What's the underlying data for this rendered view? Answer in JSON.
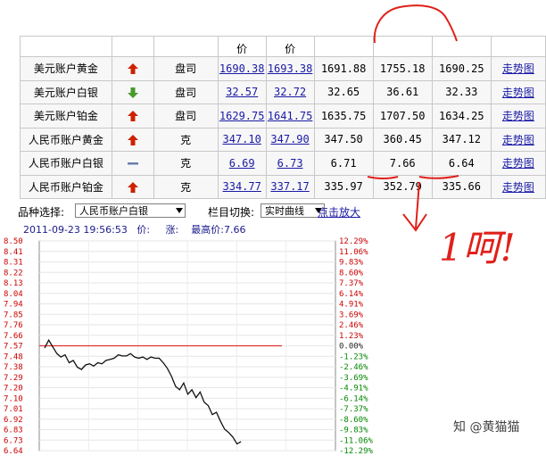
{
  "table": {
    "headers": [
      "",
      "",
      "",
      "价",
      "价",
      "",
      "",
      "",
      ""
    ],
    "rows": [
      {
        "name": "美元账户黄金",
        "dir": "up",
        "unit": "盘司",
        "bid": "1690.38",
        "ask": "1693.38",
        "mid": "1691.88",
        "high": "1755.18",
        "low": "1690.25",
        "trend": "走势图"
      },
      {
        "name": "美元账户白银",
        "dir": "down",
        "unit": "盘司",
        "bid": "32.57",
        "ask": "32.72",
        "mid": "32.65",
        "high": "36.61",
        "low": "32.33",
        "trend": "走势图"
      },
      {
        "name": "美元账户铂金",
        "dir": "up",
        "unit": "盘司",
        "bid": "1629.75",
        "ask": "1641.75",
        "mid": "1635.75",
        "high": "1707.50",
        "low": "1634.25",
        "trend": "走势图"
      },
      {
        "name": "人民币账户黄金",
        "dir": "up",
        "unit": "克",
        "bid": "347.10",
        "ask": "347.90",
        "mid": "347.50",
        "high": "360.45",
        "low": "347.12",
        "trend": "走势图"
      },
      {
        "name": "人民币账户白银",
        "dir": "flat",
        "unit": "克",
        "bid": "6.69",
        "ask": "6.73",
        "mid": "6.71",
        "high": "7.66",
        "low": "6.64",
        "trend": "走势图"
      },
      {
        "name": "人民币账户铂金",
        "dir": "up",
        "unit": "克",
        "bid": "334.77",
        "ask": "337.17",
        "mid": "335.97",
        "high": "352.79",
        "low": "335.66",
        "trend": "走势图"
      }
    ]
  },
  "controls": {
    "variety_label": "品种选择:",
    "variety_value": "人民币账户白银",
    "column_label": "栏目切换:",
    "column_value": "实时曲线",
    "enlarge_link": "点击放大"
  },
  "info": {
    "datetime": "2011-09-23 19:56:53",
    "price_label": "价:",
    "change_label": "涨:",
    "high_label": "最高价:",
    "high_value": "7.66"
  },
  "annotation": {
    "text": "1呵!"
  },
  "watermark": "知 @黄猫猫",
  "colors": {
    "up": "#cc2200",
    "down": "#4a9a2a",
    "flat": "#6a7fb0",
    "link": "#1a1aa6",
    "ref_line": "#e03030",
    "pct_up": "#cc0000",
    "pct_down": "#008800",
    "ink": "#e0201a"
  },
  "chart_data": {
    "type": "line",
    "y_left_ticks": [
      "8.50",
      "8.41",
      "8.31",
      "8.22",
      "8.13",
      "8.04",
      "7.94",
      "7.85",
      "7.76",
      "7.66",
      "7.57",
      "7.48",
      "7.38",
      "7.29",
      "7.20",
      "7.10",
      "7.01",
      "6.92",
      "6.83",
      "6.73",
      "6.64"
    ],
    "y_right_ticks": [
      "12.29%",
      "11.06%",
      "9.83%",
      "8.60%",
      "7.37%",
      "6.14%",
      "4.91%",
      "3.69%",
      "2.46%",
      "1.23%",
      "0.00%",
      "-1.23%",
      "-2.46%",
      "-3.69%",
      "-4.91%",
      "-6.14%",
      "-7.37%",
      "-8.60%",
      "-9.83%",
      "-11.06%",
      "-12.29%"
    ],
    "ylim": [
      6.64,
      8.5
    ],
    "reference": 7.57,
    "x": [
      0,
      5,
      10,
      15,
      20,
      25,
      30,
      35,
      40,
      45,
      50,
      55,
      60,
      65,
      70,
      75,
      80,
      85,
      90,
      95,
      100,
      105,
      110,
      115,
      120,
      125,
      130,
      135,
      140,
      145,
      150,
      155,
      160,
      165,
      170,
      175,
      180,
      185,
      190,
      195,
      200,
      205,
      210,
      215,
      220,
      225,
      230,
      235,
      240,
      245,
      250,
      255,
      260,
      265,
      270,
      275,
      280,
      285,
      290
    ],
    "values": [
      7.55,
      7.62,
      7.56,
      7.5,
      7.47,
      7.49,
      7.42,
      7.44,
      7.38,
      7.36,
      7.4,
      7.41,
      7.39,
      7.42,
      7.41,
      7.44,
      7.45,
      7.46,
      7.49,
      7.48,
      7.48,
      7.5,
      7.47,
      7.46,
      7.47,
      7.45,
      7.47,
      7.46,
      7.46,
      7.42,
      7.37,
      7.3,
      7.21,
      7.18,
      7.24,
      7.14,
      7.18,
      7.11,
      7.16,
      7.07,
      7.04,
      6.96,
      6.98,
      6.9,
      6.83,
      6.8,
      6.76,
      6.7,
      6.72
    ]
  }
}
